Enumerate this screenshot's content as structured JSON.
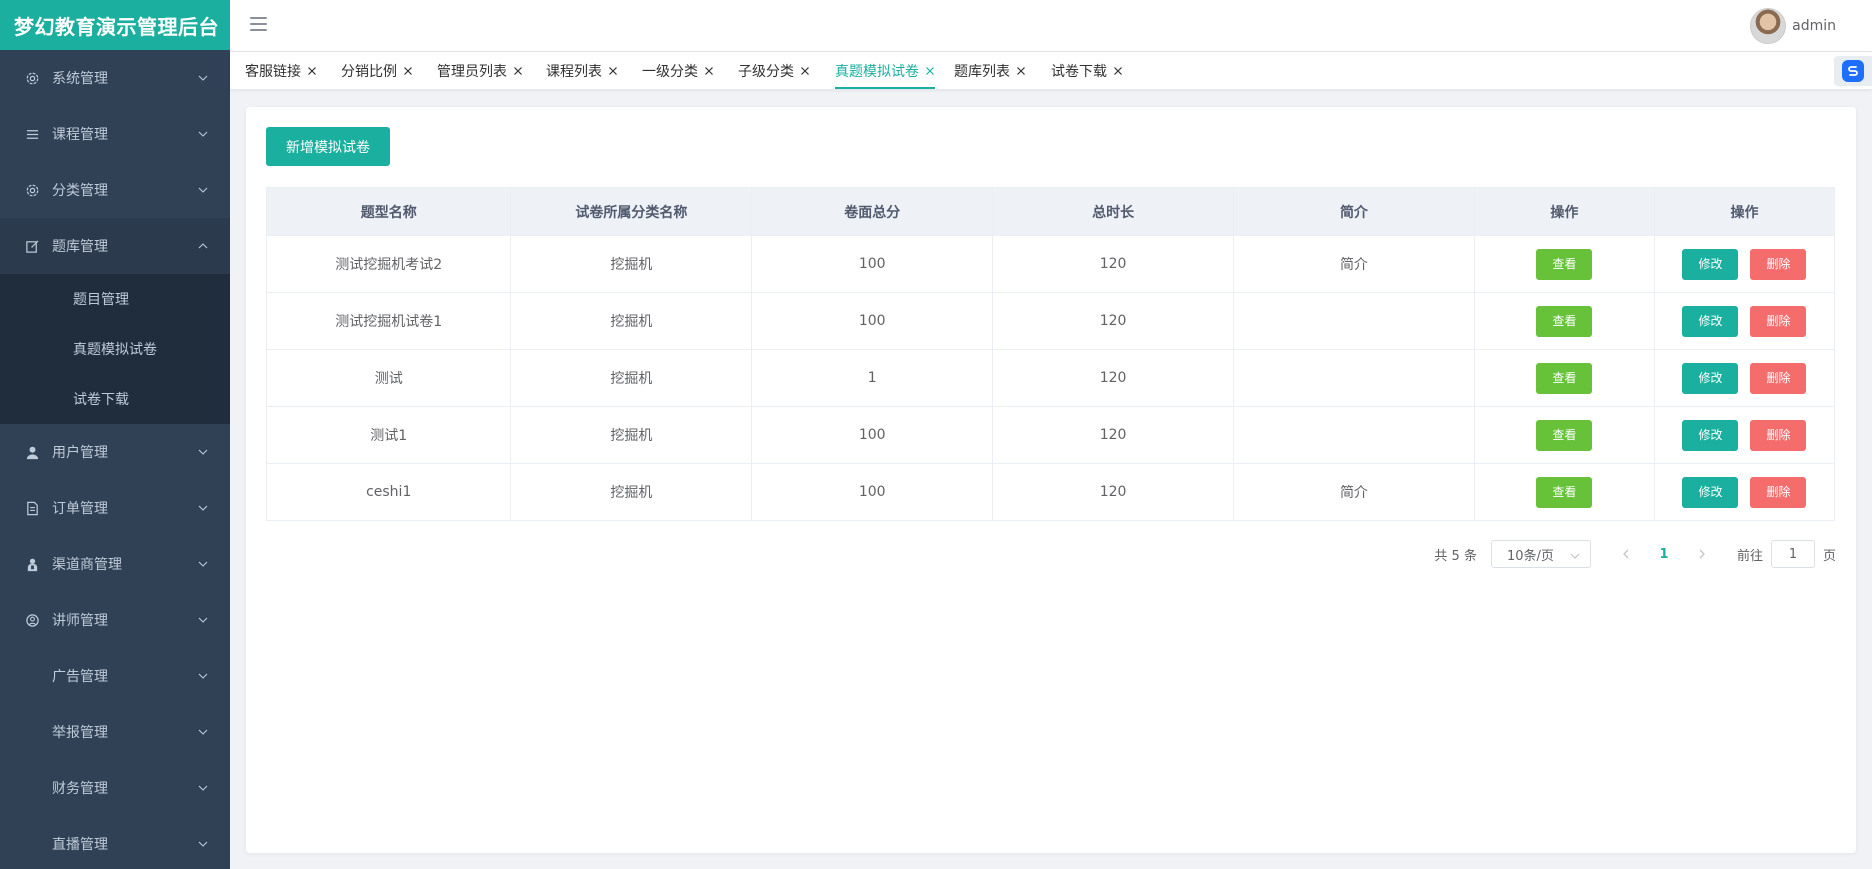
{
  "brand": "梦幻教育演示管理后台",
  "header": {
    "user_name": "admin"
  },
  "sidebar": {
    "items": [
      {
        "label": "系统管理",
        "icon": "gear-icon"
      },
      {
        "label": "课程管理",
        "icon": "list-icon"
      },
      {
        "label": "分类管理",
        "icon": "gear-icon"
      },
      {
        "label": "题库管理",
        "icon": "edit-icon",
        "open": true,
        "children": [
          "题目管理",
          "真题模拟试卷",
          "试卷下载"
        ]
      },
      {
        "label": "用户管理",
        "icon": "user-icon"
      },
      {
        "label": "订单管理",
        "icon": "document-icon"
      },
      {
        "label": "渠道商管理",
        "icon": "agent-icon"
      },
      {
        "label": "讲师管理",
        "icon": "teacher-icon"
      },
      {
        "label": "广告管理",
        "icon": ""
      },
      {
        "label": "举报管理",
        "icon": ""
      },
      {
        "label": "财务管理",
        "icon": ""
      },
      {
        "label": "直播管理",
        "icon": ""
      }
    ]
  },
  "tabs": [
    {
      "label": "客服链接"
    },
    {
      "label": "分销比例"
    },
    {
      "label": "管理员列表"
    },
    {
      "label": "课程列表"
    },
    {
      "label": "一级分类"
    },
    {
      "label": "子级分类"
    },
    {
      "label": "真题模拟试卷",
      "active": true
    },
    {
      "label": "题库列表"
    },
    {
      "label": "试卷下载"
    }
  ],
  "main": {
    "add_button": "新增模拟试卷",
    "table": {
      "headers": [
        "题型名称",
        "试卷所属分类名称",
        "卷面总分",
        "总时长",
        "简介",
        "操作",
        "操作"
      ],
      "rows": [
        [
          "测试挖掘机考试2",
          "挖掘机",
          "100",
          "120",
          "简介"
        ],
        [
          "测试挖掘机试卷1",
          "挖掘机",
          "100",
          "120",
          ""
        ],
        [
          "测试",
          "挖掘机",
          "1",
          "120",
          ""
        ],
        [
          "测试1",
          "挖掘机",
          "100",
          "120",
          ""
        ],
        [
          "ceshi1",
          "挖掘机",
          "100",
          "120",
          "简介"
        ]
      ],
      "view_label": "查看",
      "edit_label": "修改",
      "delete_label": "删除"
    },
    "pagination": {
      "total": "共 5 条",
      "page_size": "10条/页",
      "current_page": "1",
      "goto_prefix": "前往",
      "goto_value": "1",
      "goto_suffix": "页"
    }
  },
  "colors": {
    "brand": "#1aaf9e",
    "sidebar_bg": "#304156",
    "view": "#67c23a",
    "delete": "#f56c6c"
  }
}
